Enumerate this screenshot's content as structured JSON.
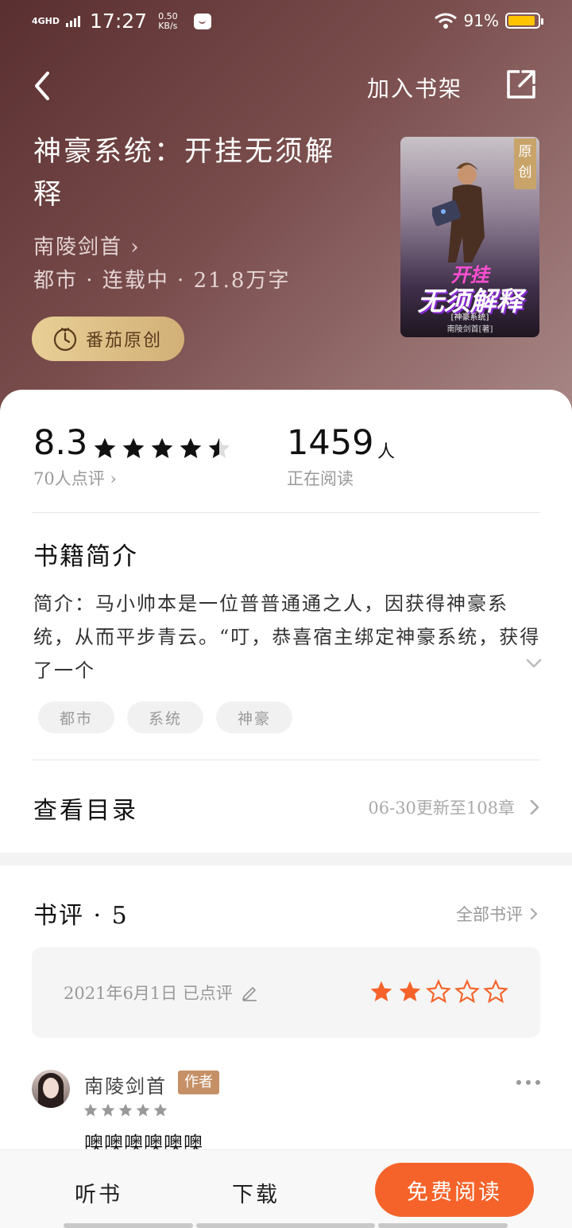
{
  "status_bar": {
    "network": "4GHD",
    "time": "17:27",
    "speed_value": "0.50",
    "speed_unit": "KB/s",
    "battery": "91%",
    "battery_level": 0.91,
    "battery_color": "#ffc400"
  },
  "nav": {
    "back_icon": "chevron-left-icon",
    "add_shelf_label": "加入书架",
    "share_icon": "share-icon"
  },
  "book": {
    "title": "神豪系统：开挂无须解释",
    "author": "南陵剑首 ›",
    "meta": "都市 · 连载中 · 21.8万字",
    "badge_label": "番茄原创",
    "cover": {
      "corner_label": "原创",
      "line1": "开挂",
      "line2": "无须解释",
      "line3": "[神豪系统]",
      "line4": "南陵剑首[著]"
    }
  },
  "stats": {
    "score": "8.3",
    "stars_value": 4.5,
    "review_count": "70人点评 ›",
    "readers": "1459",
    "readers_unit": "人",
    "readers_label": "正在阅读"
  },
  "intro": {
    "heading": "书籍简介",
    "text": "简介：马小帅本是一位普普通通之人，因获得神豪系统，从而平步青云。“叮，恭喜宿主绑定神豪系统，获得了一个",
    "expand_icon": "chevron-down-icon",
    "tags": [
      "都市",
      "系统",
      "神豪"
    ]
  },
  "catalog": {
    "label": "查看目录",
    "update": "06-30更新至108章",
    "arrow_icon": "chevron-right-icon"
  },
  "reviews": {
    "heading": "书评 · 5",
    "all_label": "全部书评",
    "my_review": {
      "date": "2021年6月1日 已点评",
      "edit_icon": "pencil-icon",
      "stars_value": 2,
      "star_color": "#f5632a"
    },
    "comment": {
      "author": "南陵剑首",
      "author_tag": "作者",
      "stars_value": 5,
      "text": "噢噢噢噢噢噢",
      "more_icon": "more-dots-icon"
    }
  },
  "bottom": {
    "listen_label": "听书",
    "download_label": "下载",
    "read_label": "免费阅读",
    "accent": "#f5632a"
  }
}
